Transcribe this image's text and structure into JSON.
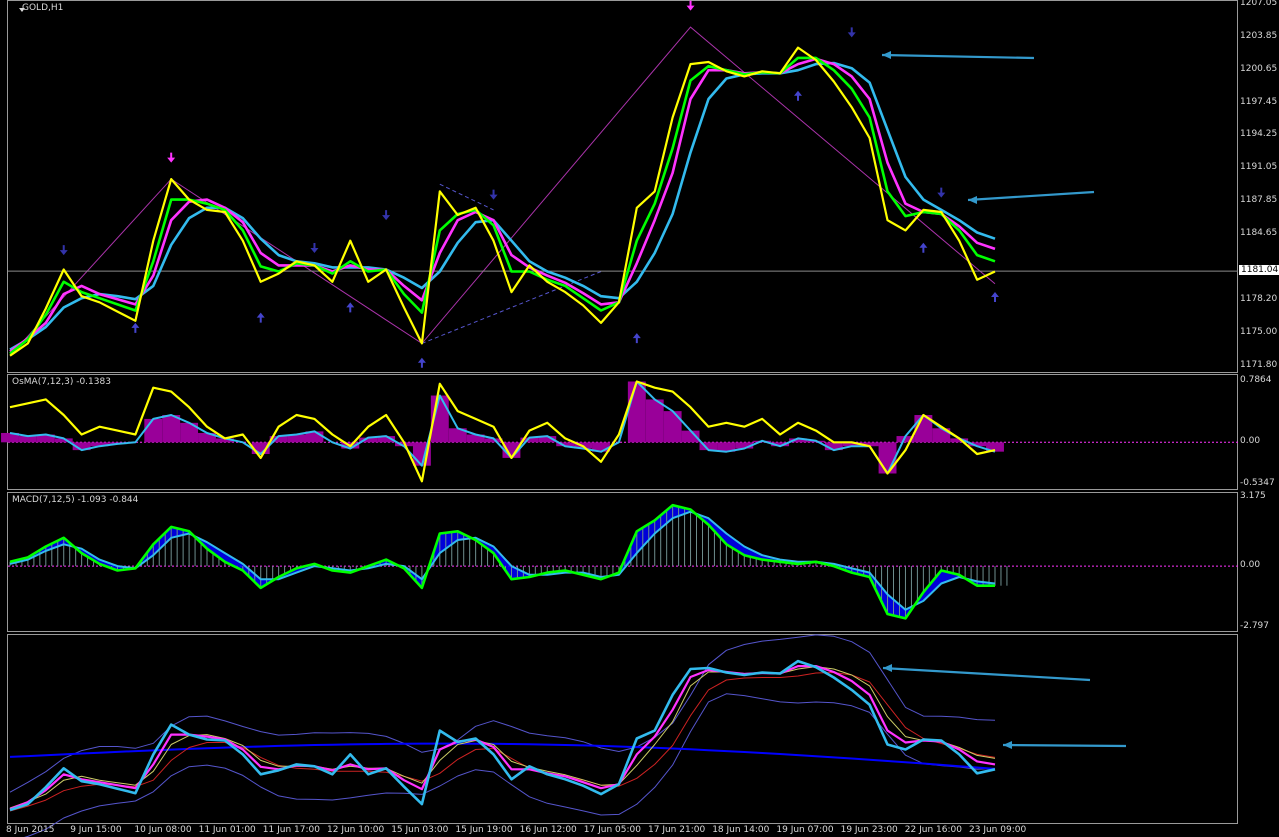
{
  "chart_window": {
    "symbol_label": "GOLD,H1"
  },
  "indicator_labels": {
    "osma": "OsMA(7,12,3) -0.1383",
    "macd": "MACD(7,12,5) -1.093 -0.844"
  },
  "colors": {
    "background": "#000000",
    "yellow_line": "#ffff00",
    "green_line": "#00ff00",
    "magenta_line": "#ff33ff",
    "cyan_line": "#33bbee",
    "zigzag": "#aa33aa",
    "up_arrow": "#4444cc",
    "down_arrow": "#3333aa",
    "annotation_arrow": "#3399cc",
    "osma_hist": "#990099",
    "macd_blue": "#0000ff",
    "bb_band": "#5555cc"
  },
  "chart_data": [
    {
      "type": "line",
      "name": "price",
      "y_ticks": [
        "1207.05",
        "1203.85",
        "1200.65",
        "1197.45",
        "1194.25",
        "1191.05",
        "1187.85",
        "1184.65",
        "1178.20",
        "1175.00",
        "1171.80"
      ],
      "current_price": "1181.04",
      "ylim": [
        1171.8,
        1207.05
      ],
      "x_ticks": [
        "8 Jun 2015",
        "9 Jun 15:00",
        "10 Jun 08:00",
        "11 Jun 01:00",
        "11 Jun 17:00",
        "12 Jun 10:00",
        "15 Jun 03:00",
        "15 Jun 19:00",
        "16 Jun 12:00",
        "17 Jun 05:00",
        "17 Jun 21:00",
        "18 Jun 14:00",
        "19 Jun 07:00",
        "19 Jun 23:00",
        "22 Jun 16:00",
        "23 Jun 09:00"
      ],
      "series": [
        {
          "values": [
            1172.8,
            1174.0,
            1177.4,
            1181.2,
            1178.6,
            1178.0,
            1177.1,
            1176.2,
            1184.0,
            1190.0,
            1188.0,
            1187.0,
            1186.8,
            1184.0,
            1180.0,
            1180.8,
            1182.0,
            1181.6,
            1180.0,
            1184.0,
            1180.0,
            1181.2,
            1177.5,
            1174.0,
            1188.8,
            1186.5,
            1187.2,
            1184.0,
            1179.0,
            1181.6,
            1180.0,
            1179.0,
            1177.7,
            1176.0,
            1178.0,
            1187.2,
            1188.8,
            1196.0,
            1201.2,
            1201.4,
            1200.5,
            1200.0,
            1200.5,
            1200.3,
            1202.8,
            1201.6,
            1199.5,
            1197.0,
            1194.0,
            1186.0,
            1185.0,
            1187.0,
            1186.8,
            1184.0,
            1180.2,
            1181.0
          ]
        },
        {
          "values": [
            1173.0,
            1174.4,
            1176.8,
            1180.0,
            1179.0,
            1178.4,
            1177.8,
            1177.2,
            1182.0,
            1188.0,
            1188.0,
            1187.6,
            1187.0,
            1185.0,
            1181.5,
            1181.0,
            1181.8,
            1181.6,
            1180.8,
            1182.0,
            1181.0,
            1181.2,
            1178.8,
            1177.0,
            1185.0,
            1186.6,
            1187.0,
            1185.5,
            1181.0,
            1181.0,
            1180.2,
            1179.6,
            1178.4,
            1177.2,
            1178.0,
            1184.0,
            1187.6,
            1193.0,
            1199.6,
            1201.0,
            1200.6,
            1200.2,
            1200.4,
            1200.3,
            1201.8,
            1201.8,
            1200.6,
            1198.8,
            1196.0,
            1188.8,
            1186.4,
            1186.8,
            1186.6,
            1185.0,
            1182.6,
            1182.0
          ]
        },
        {
          "values": [
            1173.2,
            1174.5,
            1176.0,
            1178.8,
            1179.6,
            1178.8,
            1178.3,
            1177.8,
            1180.6,
            1186.0,
            1187.8,
            1188.0,
            1187.2,
            1185.8,
            1182.8,
            1181.6,
            1181.6,
            1181.6,
            1181.0,
            1181.6,
            1181.2,
            1181.2,
            1179.6,
            1178.2,
            1182.8,
            1186.0,
            1186.8,
            1186.0,
            1182.6,
            1181.4,
            1180.6,
            1179.9,
            1178.9,
            1177.8,
            1178.0,
            1181.8,
            1186.0,
            1190.6,
            1197.8,
            1200.6,
            1200.6,
            1200.3,
            1200.4,
            1200.3,
            1201.2,
            1201.7,
            1201.2,
            1200.0,
            1197.8,
            1191.6,
            1187.6,
            1186.8,
            1186.6,
            1185.4,
            1183.8,
            1183.2
          ]
        },
        {
          "values": [
            1173.4,
            1174.4,
            1175.6,
            1177.5,
            1178.4,
            1178.8,
            1178.6,
            1178.3,
            1179.6,
            1183.6,
            1186.2,
            1187.2,
            1187.2,
            1186.2,
            1184.2,
            1182.6,
            1182.0,
            1181.8,
            1181.4,
            1181.4,
            1181.4,
            1181.2,
            1180.4,
            1179.4,
            1181.0,
            1183.8,
            1185.8,
            1186.0,
            1184.0,
            1182.0,
            1181.0,
            1180.4,
            1179.6,
            1178.6,
            1178.4,
            1180.0,
            1182.8,
            1186.6,
            1192.6,
            1197.8,
            1199.8,
            1200.2,
            1200.3,
            1200.3,
            1200.6,
            1201.2,
            1201.3,
            1200.8,
            1199.4,
            1194.8,
            1190.2,
            1188.0,
            1187.0,
            1186.0,
            1184.8,
            1184.2
          ]
        }
      ]
    },
    {
      "type": "bar",
      "name": "osma",
      "y_ticks": [
        "0.7864",
        "0.00",
        "-0.5347"
      ],
      "ylim": [
        -0.5347,
        0.7864
      ],
      "values": [
        0.12,
        0.08,
        0.1,
        0.05,
        -0.1,
        -0.05,
        -0.02,
        0.0,
        0.3,
        0.35,
        0.25,
        0.12,
        0.05,
        0.0,
        -0.15,
        0.08,
        0.1,
        0.14,
        0.0,
        -0.08,
        0.06,
        0.08,
        -0.05,
        -0.3,
        0.6,
        0.18,
        0.1,
        0.05,
        -0.2,
        0.06,
        0.08,
        -0.05,
        -0.08,
        -0.12,
        0.0,
        0.78,
        0.55,
        0.4,
        0.15,
        -0.1,
        -0.12,
        -0.08,
        0.02,
        -0.05,
        0.05,
        0.02,
        -0.1,
        -0.05,
        -0.05,
        -0.4,
        0.08,
        0.35,
        0.18,
        0.05,
        -0.05,
        -0.12
      ],
      "osc": [
        0.45,
        0.5,
        0.55,
        0.35,
        0.1,
        0.2,
        0.15,
        0.1,
        0.7,
        0.65,
        0.45,
        0.2,
        0.05,
        0.1,
        -0.2,
        0.2,
        0.35,
        0.3,
        0.1,
        -0.05,
        0.2,
        0.35,
        0.0,
        -0.5,
        0.75,
        0.4,
        0.3,
        0.2,
        -0.2,
        0.15,
        0.25,
        0.05,
        -0.05,
        -0.25,
        0.1,
        0.78,
        0.7,
        0.65,
        0.45,
        0.2,
        0.25,
        0.2,
        0.3,
        0.1,
        0.25,
        0.15,
        0.0,
        0.0,
        -0.05,
        -0.4,
        -0.1,
        0.35,
        0.2,
        0.05,
        -0.15,
        -0.1
      ]
    },
    {
      "type": "bar",
      "name": "macd",
      "y_ticks": [
        "3.175",
        "0.00",
        "-2.797"
      ],
      "ylim": [
        -2.797,
        3.175
      ],
      "values": [
        0.2,
        0.4,
        0.9,
        1.3,
        0.6,
        0.1,
        -0.2,
        -0.1,
        1.0,
        1.8,
        1.6,
        0.8,
        0.2,
        -0.2,
        -1.0,
        -0.5,
        -0.1,
        0.1,
        -0.2,
        -0.3,
        0.0,
        0.3,
        -0.1,
        -1.0,
        1.5,
        1.6,
        1.2,
        0.6,
        -0.6,
        -0.5,
        -0.3,
        -0.2,
        -0.4,
        -0.6,
        -0.3,
        1.6,
        2.1,
        2.8,
        2.6,
        1.9,
        1.0,
        0.5,
        0.3,
        0.2,
        0.1,
        0.2,
        0.0,
        -0.3,
        -0.5,
        -2.2,
        -2.4,
        -1.2,
        -0.2,
        -0.4,
        -0.9,
        -0.9
      ],
      "signal": [
        0.1,
        0.3,
        0.7,
        1.0,
        0.8,
        0.3,
        0.0,
        -0.1,
        0.5,
        1.3,
        1.5,
        1.1,
        0.6,
        0.1,
        -0.6,
        -0.6,
        -0.3,
        0.0,
        -0.1,
        -0.2,
        -0.1,
        0.1,
        0.0,
        -0.6,
        0.6,
        1.2,
        1.3,
        0.9,
        0.0,
        -0.4,
        -0.4,
        -0.3,
        -0.3,
        -0.5,
        -0.4,
        0.6,
        1.5,
        2.2,
        2.5,
        2.2,
        1.5,
        0.9,
        0.5,
        0.3,
        0.2,
        0.2,
        0.1,
        -0.1,
        -0.3,
        -1.3,
        -2.0,
        -1.6,
        -0.8,
        -0.5,
        -0.7,
        -0.8
      ]
    }
  ]
}
